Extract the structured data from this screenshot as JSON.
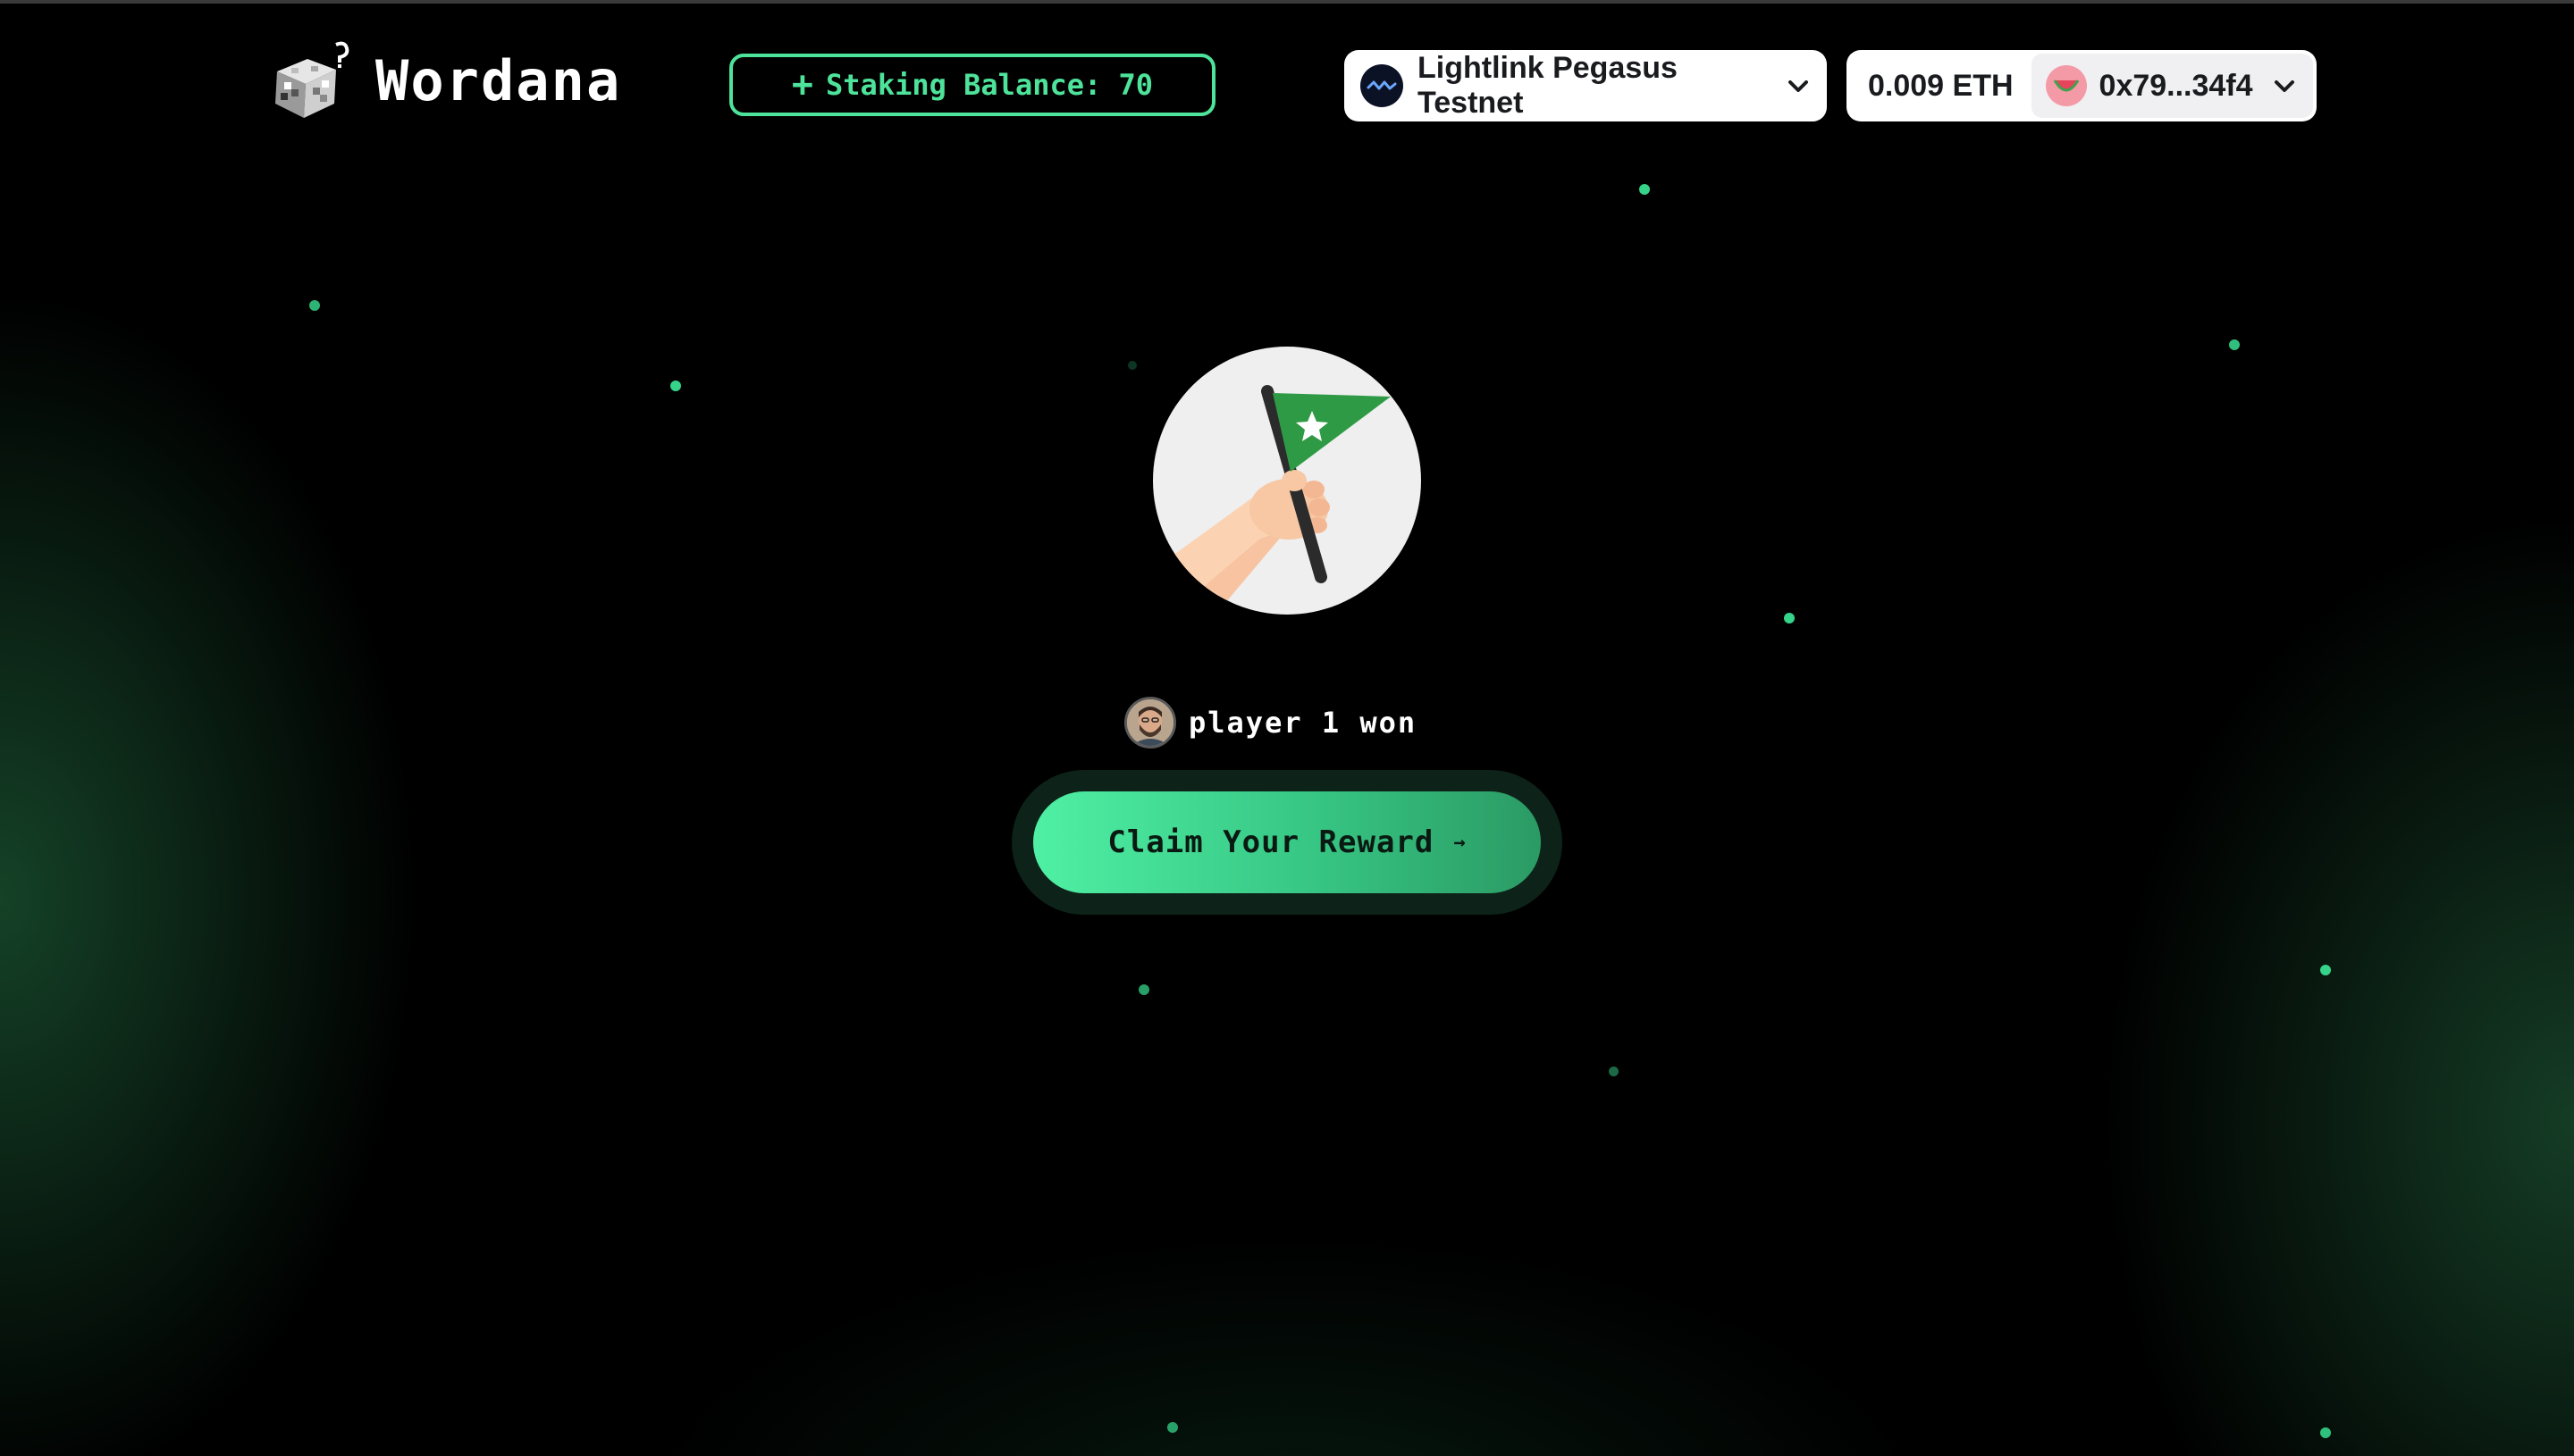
{
  "header": {
    "logo_text": "Wordana",
    "staking": {
      "icon": "plus-icon",
      "label": "Staking Balance: 70"
    },
    "network": {
      "icon": "lightlink-icon",
      "label": "Lightlink Pegasus Testnet"
    },
    "account": {
      "balance": "0.009 ETH",
      "avatar_icon": "watermelon-avatar",
      "address": "0x79...34f4"
    }
  },
  "main": {
    "illustration": "hand-holding-flag",
    "winner_text": "player 1 won",
    "claim_button": "Claim Your Reward",
    "claim_arrow": "→"
  },
  "colors": {
    "accent": "#4ee39a",
    "background": "#000000",
    "flag_green": "#2f9a45"
  }
}
